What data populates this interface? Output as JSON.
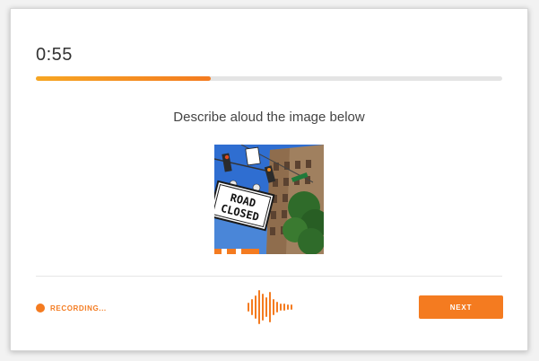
{
  "timer": {
    "text": "0:55"
  },
  "progress": {
    "fraction": 0.375
  },
  "prompt": {
    "text": "Describe aloud the image below"
  },
  "image": {
    "sign_line1": "ROAD",
    "sign_line2": "CLOSED"
  },
  "status": {
    "recording_label": "RECORDING..."
  },
  "actions": {
    "next_label": "NEXT"
  },
  "colors": {
    "accent": "#f47b20",
    "accent_light": "#f6a623",
    "track": "#e4e4e4"
  },
  "icons": {
    "recording": "record-dot-icon",
    "audio": "sound-wave-icon"
  }
}
